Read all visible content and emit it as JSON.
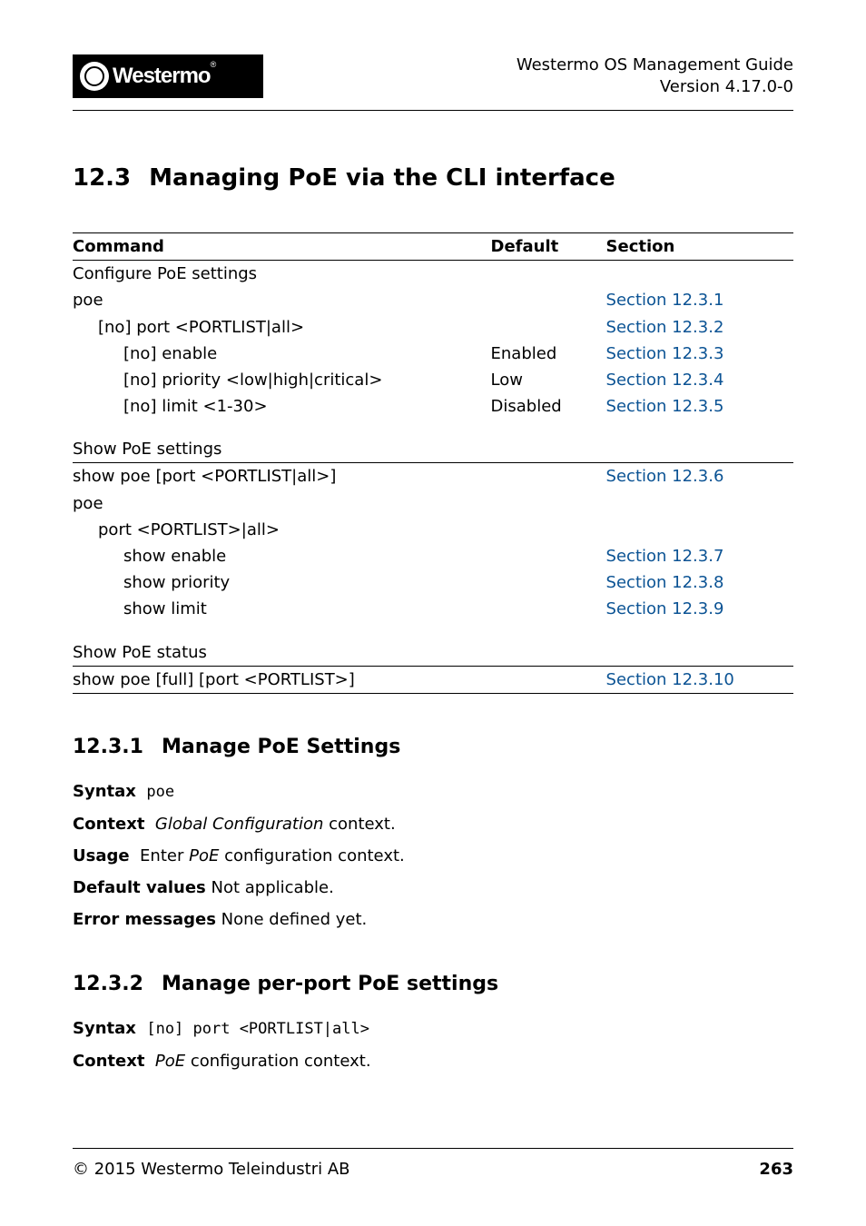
{
  "header": {
    "logo_text": "Westermo",
    "title_line1": "Westermo OS Management Guide",
    "title_line2": "Version 4.17.0-0"
  },
  "section": {
    "number": "12.3",
    "title": "Managing PoE via the CLI interface"
  },
  "table": {
    "headers": {
      "command": "Command",
      "default": "Default",
      "section": "Section"
    },
    "group1": {
      "title": "Configure PoE settings",
      "rows": {
        "r0": {
          "cmd": "poe",
          "def": "",
          "sec": "Section 12.3.1"
        },
        "r1": {
          "cmd": "[no] port <PORTLIST|all>",
          "def": "",
          "sec": "Section 12.3.2"
        },
        "r2": {
          "cmd": "[no] enable",
          "def": "Enabled",
          "sec": "Section 12.3.3"
        },
        "r3": {
          "cmd": "[no] priority <low|high|critical>",
          "def": "Low",
          "sec": "Section 12.3.4"
        },
        "r4": {
          "cmd": "[no] limit <1-30>",
          "def": "Disabled",
          "sec": "Section 12.3.5"
        }
      }
    },
    "group2": {
      "title": "Show PoE settings",
      "rows": {
        "r0": {
          "cmd": "show poe [port <PORTLIST|all>]",
          "def": "",
          "sec": "Section 12.3.6"
        },
        "r1": {
          "cmd": "poe",
          "def": "",
          "sec": ""
        },
        "r2": {
          "cmd": "port <PORTLIST>|all>",
          "def": "",
          "sec": ""
        },
        "r3": {
          "cmd": "show enable",
          "def": "",
          "sec": "Section 12.3.7"
        },
        "r4": {
          "cmd": "show priority",
          "def": "",
          "sec": "Section 12.3.8"
        },
        "r5": {
          "cmd": "show limit",
          "def": "",
          "sec": "Section 12.3.9"
        }
      }
    },
    "group3": {
      "title": "Show PoE status",
      "rows": {
        "r0": {
          "cmd": "show poe [full] [port <PORTLIST>]",
          "def": "",
          "sec": "Section 12.3.10"
        }
      }
    }
  },
  "sub1": {
    "number": "12.3.1",
    "title": "Manage PoE Settings",
    "syntax_label": "Syntax",
    "syntax_val": "poe",
    "context_label": "Context",
    "context_ital": "Global Configuration",
    "context_rest": " context.",
    "usage_label": "Usage",
    "usage_pre": "Enter ",
    "usage_ital": "PoE",
    "usage_rest": " configuration context.",
    "default_label": "Default values",
    "default_val": " Not applicable.",
    "error_label": "Error messages",
    "error_val": " None defined yet."
  },
  "sub2": {
    "number": "12.3.2",
    "title": "Manage per-port PoE settings",
    "syntax_label": "Syntax",
    "syntax_val": "[no] port <PORTLIST|all>",
    "context_label": "Context",
    "context_ital": "PoE",
    "context_rest": " configuration context."
  },
  "footer": {
    "copyright": "© 2015 Westermo Teleindustri AB",
    "page": "263"
  }
}
